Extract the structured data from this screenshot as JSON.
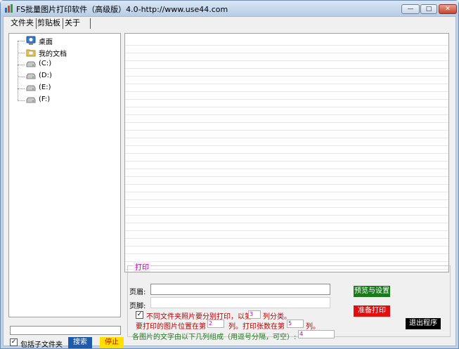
{
  "window": {
    "title": "FS批量图片打印软件（高级版）4.0-http://www.use44.com",
    "min_label": "—",
    "max_label": "□",
    "close_label": "✕"
  },
  "tabs": [
    {
      "label": "文件夹"
    },
    {
      "label": "剪贴板"
    },
    {
      "label": "关于"
    }
  ],
  "tree": {
    "items": [
      {
        "label": "桌面",
        "icon": "desktop-icon"
      },
      {
        "label": "我的文档",
        "icon": "documents-folder-icon"
      },
      {
        "label": "(C:)",
        "icon": "drive-icon"
      },
      {
        "label": "(D:)",
        "icon": "drive-icon"
      },
      {
        "label": "(E:)",
        "icon": "drive-icon"
      },
      {
        "label": "(F:)",
        "icon": "drive-icon"
      }
    ]
  },
  "bottom_left": {
    "include_subfolders_label": "包括子文件夹",
    "include_subfolders_checked": true,
    "search_label": "搜索",
    "stop_label": "停止"
  },
  "print": {
    "legend": "打印",
    "header_label": "页眉:",
    "footer_label": "页脚:",
    "header_value": "",
    "footer_value": "",
    "separate_checked": true,
    "separate_text_a": "不同文件夹照片要分别打印，以第",
    "separate_col": "3",
    "separate_text_b": "列分类。",
    "image_pos_text_a": "要打印的图片位置在第",
    "image_pos_col": "2",
    "image_pos_text_b": "列。打印张数在第",
    "count_col": "5",
    "image_pos_text_c": "列。",
    "caption_text": "各图片的文字由以下几列组成（用逗号分隔，可空）:",
    "caption_value": "4",
    "preview_label": "预览与设置",
    "ready_print_label": "准备打印",
    "exit_label": "退出程序"
  },
  "colors": {
    "green_button": "#1a7a1a",
    "red_button": "#e01010",
    "search_button": "#1e5aa8",
    "stop_button": "#ffe000",
    "legend_magenta": "#c000c0",
    "red_text": "#c00000",
    "green_text": "#1a7a1a"
  }
}
